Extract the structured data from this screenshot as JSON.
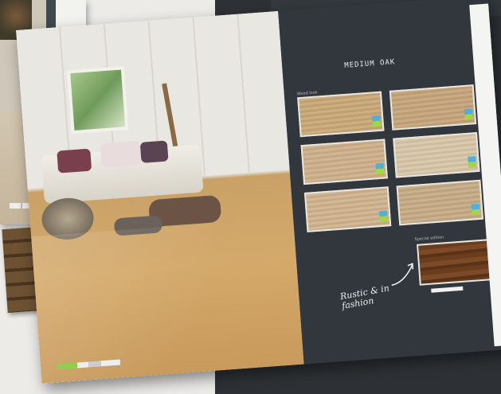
{
  "panel": {
    "title": "MEDIUM OAK",
    "subhead": "Wood look",
    "subhead2": "Special edition",
    "handwritten": "Rustic & in\nfashion"
  },
  "colors": {
    "background_dark": "#2d3135",
    "panel": "#31373c",
    "oak": "#d4a96a",
    "tag_blue": "#4fb1d9",
    "tag_green": "#a5d44b"
  },
  "swatches": [
    {
      "name": "oak-1",
      "color": "#c9a878"
    },
    {
      "name": "oak-2",
      "color": "#c6a47a"
    },
    {
      "name": "oak-3",
      "color": "#ceb08a"
    },
    {
      "name": "oak-4",
      "color": "#d9c6a8"
    },
    {
      "name": "oak-5",
      "color": "#d0b38e"
    },
    {
      "name": "oak-6",
      "color": "#c7ab85"
    }
  ],
  "feature_swatch": {
    "name": "dark-oak",
    "color": "#6a3d1f"
  }
}
